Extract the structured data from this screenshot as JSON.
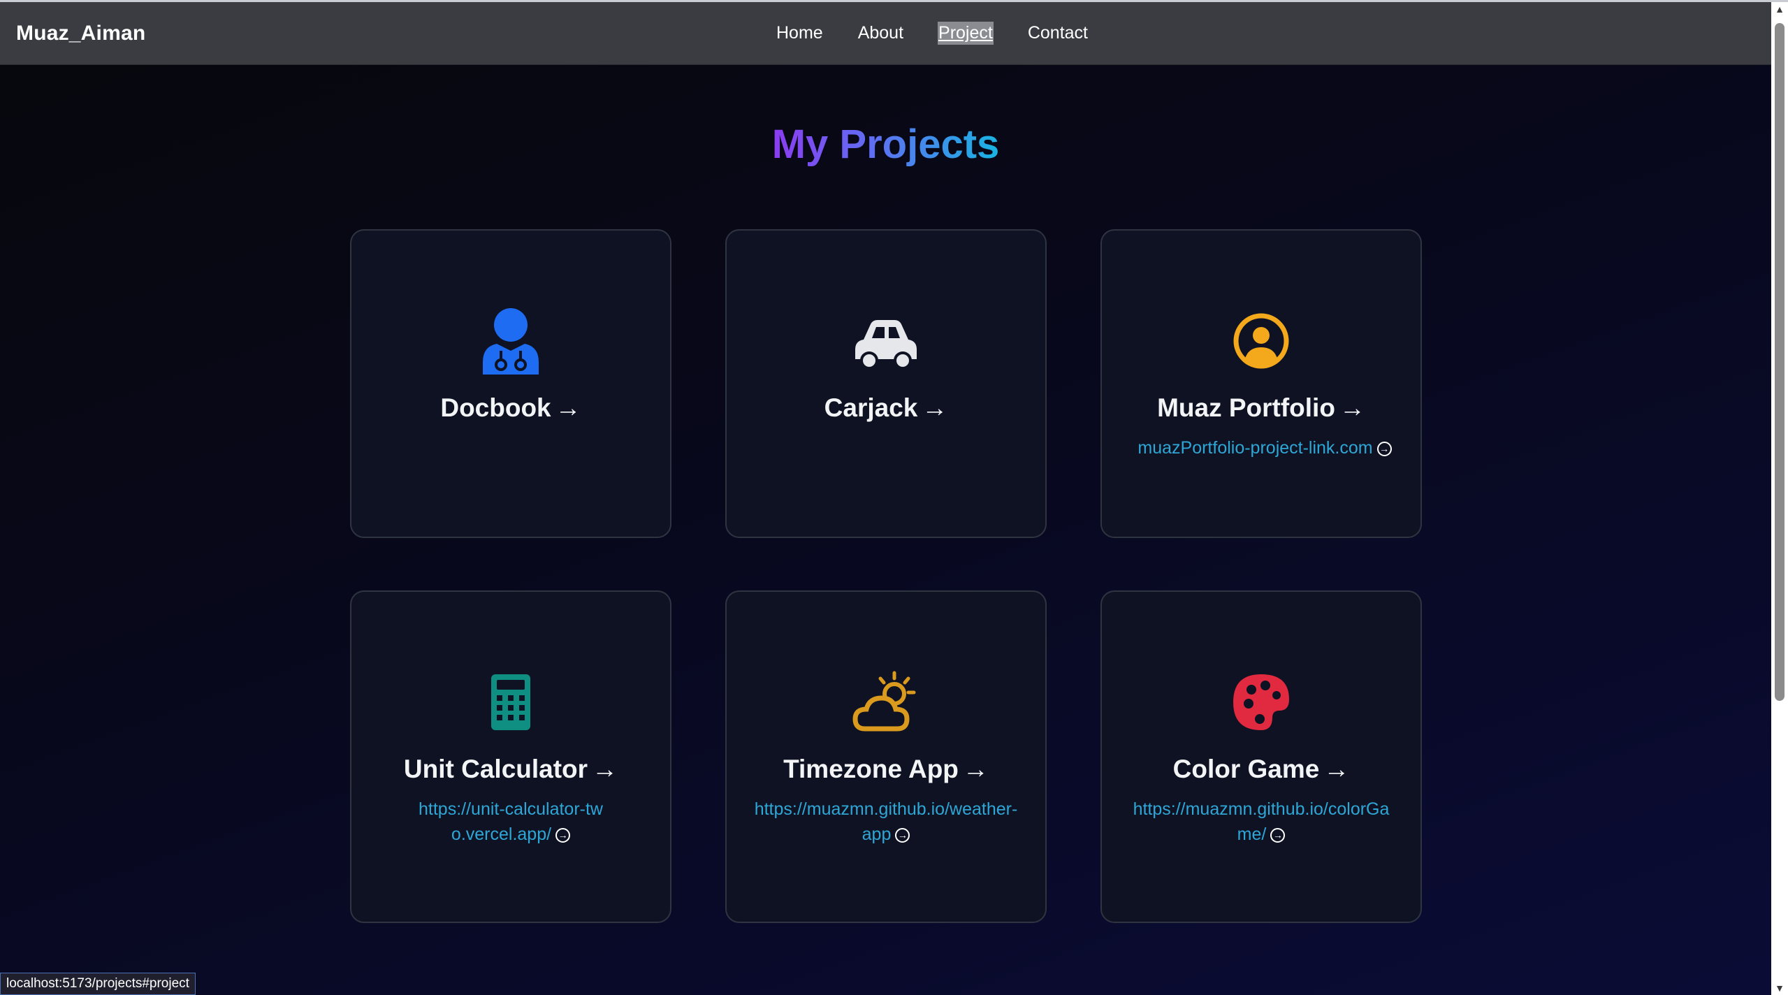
{
  "nav": {
    "brand": "Muaz_Aiman",
    "links": [
      "Home",
      "About",
      "Project",
      "Contact"
    ],
    "active": "Project"
  },
  "page": {
    "title": "My Projects"
  },
  "projects": [
    {
      "name": "Docbook",
      "icon": "doctor-icon",
      "color": "#1d6cf2",
      "link": ""
    },
    {
      "name": "Carjack",
      "icon": "car-icon",
      "color": "#e5e7eb",
      "link": ""
    },
    {
      "name": "Muaz Portfolio",
      "icon": "user-circle-icon",
      "color": "#f4a81c",
      "link": "muazPortfolio-project-link.com"
    },
    {
      "name": "Unit Calculator",
      "icon": "calculator-icon",
      "color": "#0f8f82",
      "link": "https://unit-calculator-two.vercel.app/"
    },
    {
      "name": "Timezone App",
      "icon": "cloud-sun-icon",
      "color": "#d99a1e",
      "link": "https://muazmn.github.io/weather-app"
    },
    {
      "name": "Color Game",
      "icon": "palette-icon",
      "color": "#e12a3f",
      "link": "https://muazmn.github.io/colorGame/"
    }
  ],
  "arrow": "→",
  "link_icon": "→",
  "status_bar": "localhost:5173/projects#project"
}
